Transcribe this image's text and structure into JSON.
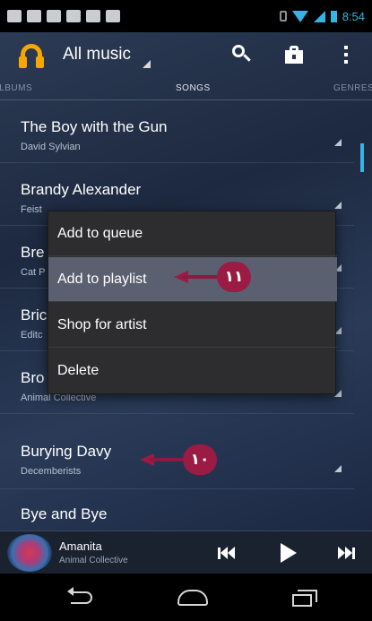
{
  "status_bar": {
    "time": "8:54"
  },
  "action_bar": {
    "title": "All music"
  },
  "tabs": [
    {
      "label": "ALBUMS"
    },
    {
      "label": "SONGS"
    },
    {
      "label": "GENRES"
    }
  ],
  "songs": [
    {
      "title": "The Boy with the Gun",
      "artist": "David Sylvian"
    },
    {
      "title": "Brandy Alexander",
      "artist": "Feist"
    },
    {
      "title": "Bre",
      "artist": "Cat P"
    },
    {
      "title": "Bric",
      "artist": "Editc"
    },
    {
      "title": "Bro",
      "artist": "Animal Collective"
    },
    {
      "title": "Burying Davy",
      "artist": "Decemberists"
    },
    {
      "title": "Bye and Bye",
      "artist": ""
    }
  ],
  "context_menu": {
    "items": [
      {
        "label": "Add to queue"
      },
      {
        "label": "Add to playlist"
      },
      {
        "label": "Shop for artist"
      },
      {
        "label": "Delete"
      }
    ]
  },
  "callouts": [
    {
      "label": "١١"
    },
    {
      "label": "١٠"
    }
  ],
  "now_playing": {
    "title": "Amanita",
    "artist": "Animal Collective"
  },
  "icons": {
    "app": "headphones-icon",
    "search": "search-icon",
    "shop": "shopping-bag-icon",
    "overflow": "overflow-menu-icon",
    "previous": "skip-previous-icon",
    "play": "play-icon",
    "next": "skip-next-icon",
    "back": "back-icon",
    "home": "home-icon",
    "recents": "recent-apps-icon"
  },
  "colors": {
    "accent": "#33b5e5",
    "app_icon": "#f6a800",
    "callout": "#9a1b44",
    "menu_background": "#2d2d2f",
    "menu_highlight": "#5b6070"
  }
}
